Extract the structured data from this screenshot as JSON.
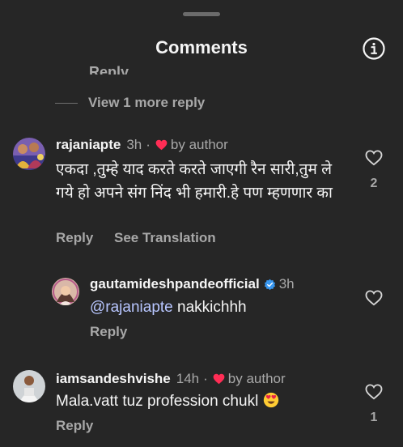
{
  "header": {
    "title": "Comments"
  },
  "clipped_reply_label": "Reply",
  "view_more_replies": "View 1 more reply",
  "comments": [
    {
      "username": "rajaniapte",
      "time": "3h",
      "separator": "·",
      "author_badge": "by author",
      "text": "एकदा ,तुम्हे याद करते करते जाएगी रैन सारी,तुम ले गये हो अपने संग निंद भी हमारी.हे पण म्हणणार का",
      "actions": [
        "Reply",
        "See Translation"
      ],
      "like_count": "2"
    },
    {
      "username": "gautamideshpandeofficial",
      "time": "3h",
      "verified": true,
      "mention": "@rajaniapte",
      "text": " nakkichhh",
      "actions": [
        "Reply"
      ],
      "like_count": ""
    },
    {
      "username": "iamsandeshvishe",
      "time": "14h",
      "separator": "·",
      "author_badge": "by author",
      "text": "Mala.vatt tuz profession chukl",
      "emoji": "heart-eyes-emoji",
      "actions": [
        "Reply"
      ],
      "like_count": "1"
    }
  ],
  "colors": {
    "background": "#262626",
    "secondary_text": "#a8a8a8",
    "mention": "#b8c6ff",
    "author_heart": "#ff2d55",
    "verified": "#3897f0"
  }
}
